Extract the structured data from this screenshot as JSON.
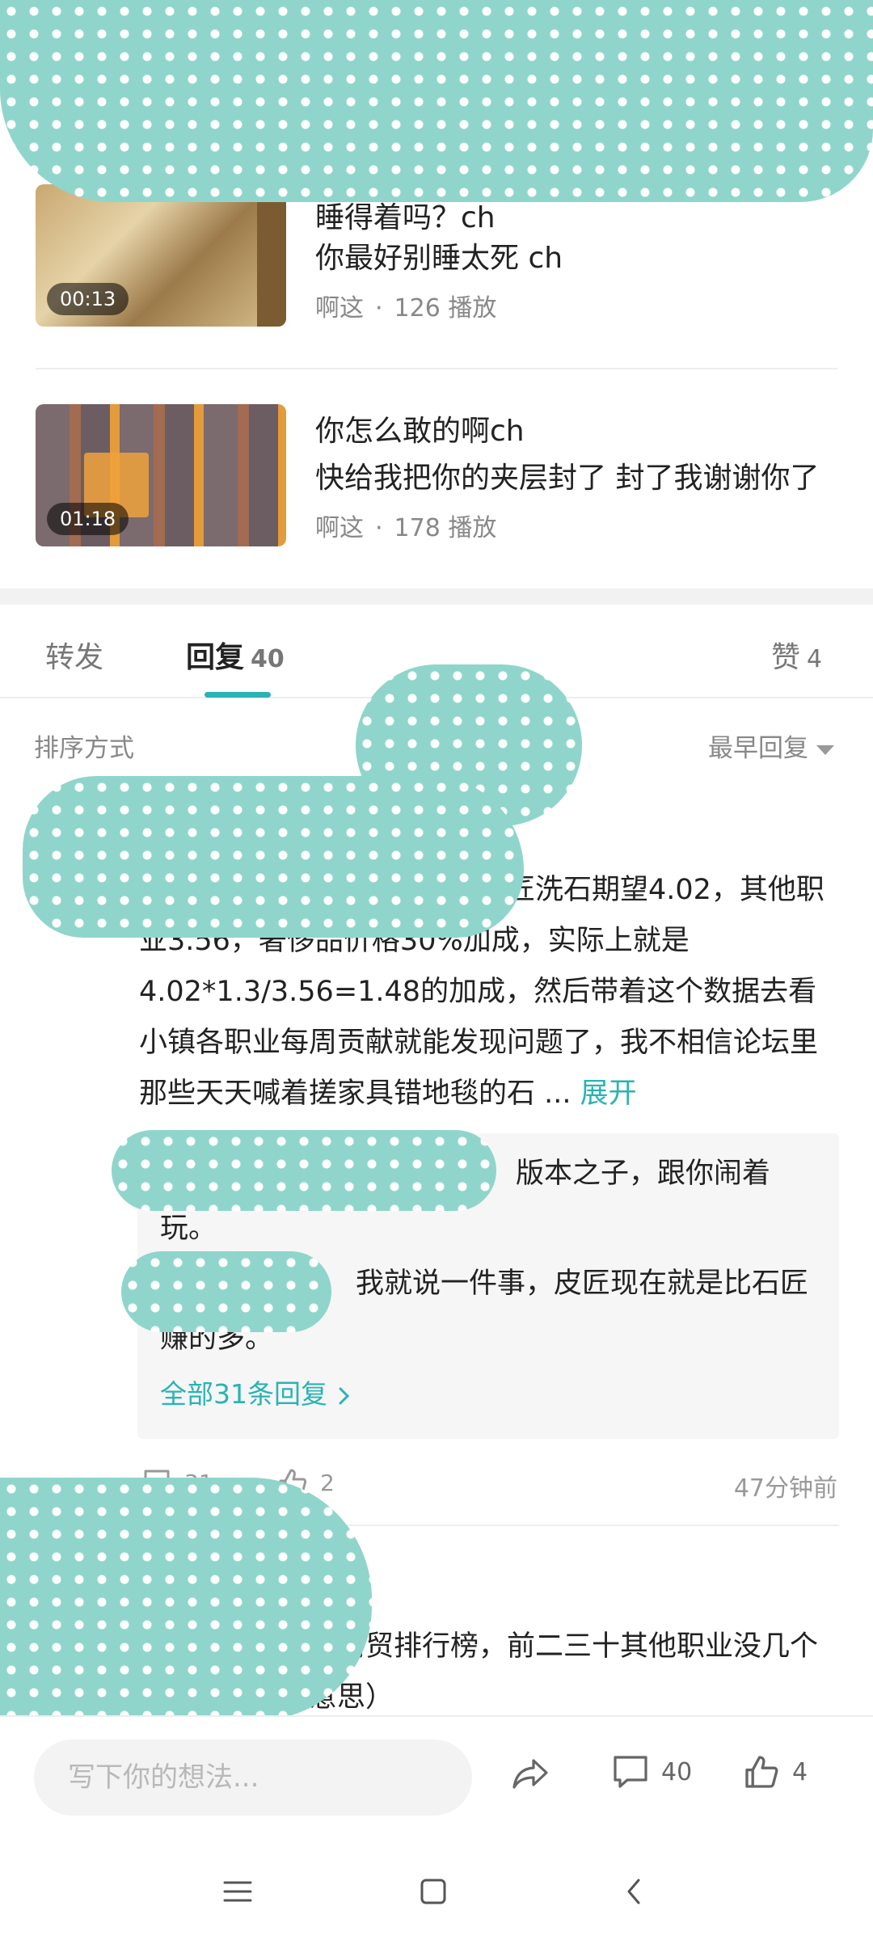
{
  "videos": [
    {
      "title": "睡得着吗？ch",
      "subtitle": "你最好别睡太死 ch",
      "author": "啊这",
      "separator": "·",
      "plays": "126 播放",
      "duration": "00:13"
    },
    {
      "title": "你怎么敢的啊ch",
      "subtitle": "快给我把你的夹层封了 封了我谢谢你了",
      "author": "啊这",
      "separator": "·",
      "plays": "178 播放",
      "duration": "01:18"
    }
  ],
  "tabs": {
    "forward": "转发",
    "reply": "回复",
    "reply_count": "40",
    "like": "赞",
    "like_count": "4"
  },
  "sort": {
    "label": "排序方式",
    "value": "最早回复"
  },
  "comment": {
    "text": "理性点算算石匠的收入吧，石匠洗石期望4.02，其他职业3.56，奢侈品价格30%加成，实际上就是4.02*1.3/3.56=1.48的加成，然后带着这个数据去看小镇各职业每周贡献就能发现问题了，我不相信论坛里那些天天喊着搓家具错地毯的石 ...",
    "expand": "展开",
    "replies": [
      {
        "text": "版本之子，跟你闹着玩。"
      },
      {
        "text": "我就说一件事，皮匠现在就是比石匠赚的多。"
      }
    ],
    "all_replies": "全部31条回复",
    "reply_count": "31",
    "like_count": "2",
    "time": "47分钟前"
  },
  "comment2": {
    "text": "虽然但是，看看商贸排行榜，前二三十其他职业没几个好像（没别的意思）"
  },
  "bottom_bar": {
    "placeholder": "写下你的想法...",
    "comment_count": "40",
    "like_count": "4"
  },
  "colors": {
    "accent": "#2bb3b3",
    "redaction": "#8fd5cb"
  },
  "icons": [
    "share-icon",
    "comment-icon",
    "thumbs-up-icon",
    "chevron-right-icon",
    "caret-down-icon",
    "menu-icon",
    "home-icon",
    "back-icon"
  ]
}
